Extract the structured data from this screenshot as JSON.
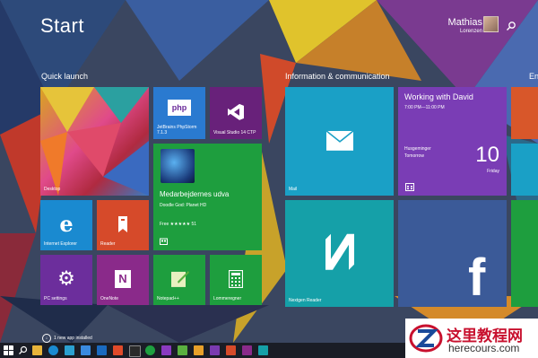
{
  "start": {
    "title": "Start"
  },
  "user": {
    "first_name": "Mathias",
    "last_name": "Lorenzen"
  },
  "groups": {
    "quick_launch": "Quick launch",
    "info": "Information & communication",
    "partial": "En"
  },
  "tiles": {
    "desktop": "Desktop",
    "phpstorm": "JetBrains PhpStorm 7.1.3",
    "phpstorm_logo": "php",
    "visualstudio": "Visual Studio 14 CTP",
    "game_title": "Medarbejdernes udva",
    "game_sub": "Doodle God: Planet HD",
    "game_rating": "Free ★★★★★ 51",
    "ie": "Internet Explorer",
    "reader": "Reader",
    "pcsettings": "PC settings",
    "onenote": "OneNote",
    "notepad": "Notepad++",
    "calculator": "Lommeregner",
    "mail": "Mail",
    "nextgen": "Nextgen Reader",
    "calendar_title": "Working with David",
    "calendar_time": "7:00 PM—11:00 PM",
    "calendar_note": "Husgeminger",
    "calendar_when": "Tomorrow",
    "calendar_day": "10",
    "calendar_weekday": "Friday"
  },
  "notice": "1 new app installed",
  "watermark": {
    "cn": "这里教程网",
    "url": "herecours.com"
  },
  "colors": {
    "mail": "#1aa0c6",
    "calendar": "#7a3db5",
    "green": "#1f9e3f",
    "purple": "#6c2e9c",
    "orange": "#d8572a",
    "teal": "#15a0a8",
    "facebook": "#3b5a98"
  }
}
